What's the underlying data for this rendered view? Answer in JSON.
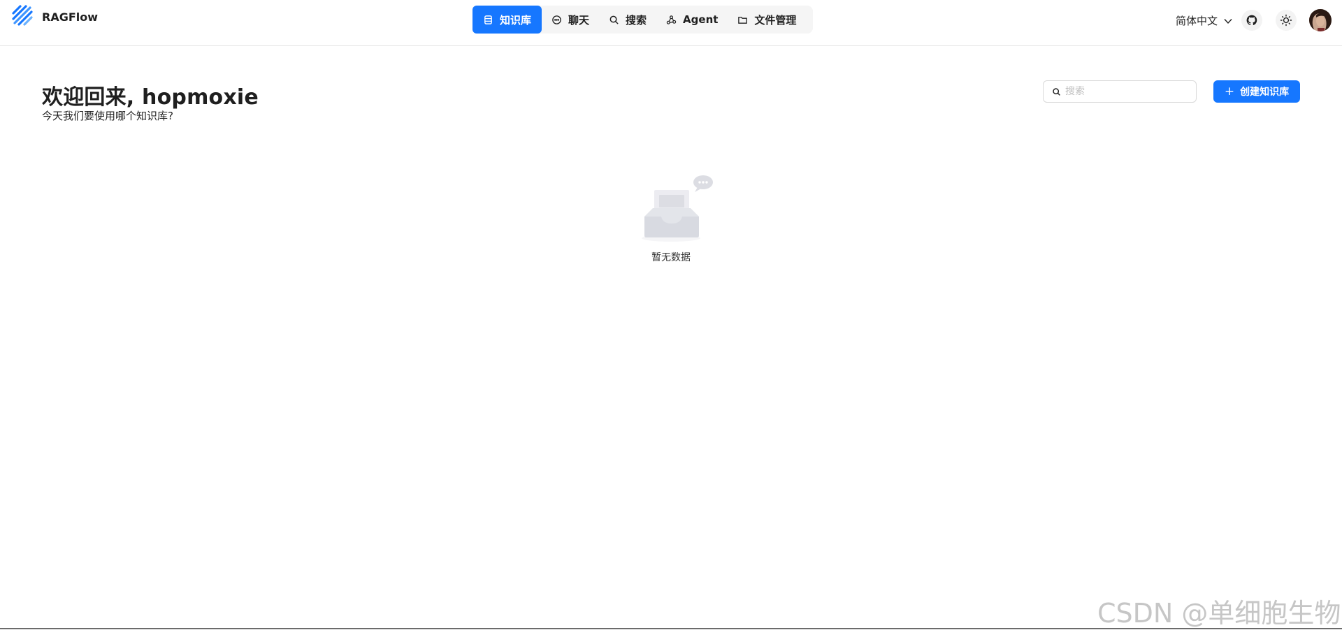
{
  "app": {
    "name": "RAGFlow"
  },
  "nav": {
    "items": [
      {
        "label": "知识库",
        "icon": "database-icon",
        "active": true
      },
      {
        "label": "聊天",
        "icon": "chat-bubble-icon",
        "active": false
      },
      {
        "label": "搜索",
        "icon": "search-icon",
        "active": false
      },
      {
        "label": "Agent",
        "icon": "agent-graph-icon",
        "active": false
      },
      {
        "label": "文件管理",
        "icon": "folder-icon",
        "active": false
      }
    ]
  },
  "header": {
    "language": "简体中文",
    "github_icon": "github-icon",
    "theme_icon": "sun-icon",
    "avatar_icon": "user-avatar"
  },
  "main": {
    "welcome": "欢迎回来, hopmoxie",
    "subtitle": "今天我们要使用哪个知识库?",
    "search_placeholder": "搜索",
    "create_button": "创建知识库",
    "empty_text": "暂无数据"
  },
  "watermark": "CSDN @单细胞生物z",
  "colors": {
    "accent": "#1677ff",
    "nav_bg": "#f5f5f5",
    "text": "#1f1f1f"
  }
}
